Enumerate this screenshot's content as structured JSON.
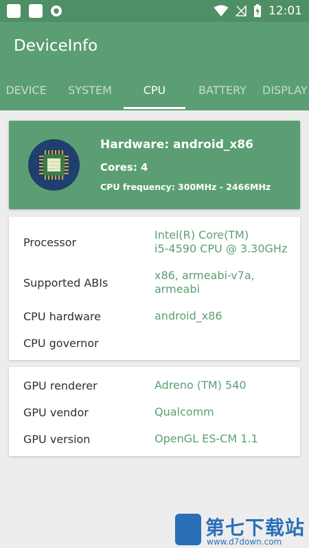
{
  "status_bar": {
    "time": "12:01"
  },
  "app_bar": {
    "title": "DeviceInfo",
    "tabs": [
      {
        "label": "DEVICE",
        "active": false
      },
      {
        "label": "SYSTEM",
        "active": false
      },
      {
        "label": "CPU",
        "active": true
      },
      {
        "label": "BATTERY",
        "active": false
      },
      {
        "label": "DISPLAY",
        "active": false
      }
    ]
  },
  "header_card": {
    "hardware": "Hardware: android_x86",
    "cores": "Cores: 4",
    "frequency": "CPU frequency: 300MHz - 2466MHz"
  },
  "cpu_card": {
    "rows": [
      {
        "label": "Processor",
        "value_line1": "Intel(R) Core(TM)",
        "value_line2": "i5-4590 CPU @ 3.30GHz"
      },
      {
        "label": "Supported ABIs",
        "value_line1": "x86, armeabi-v7a,",
        "value_line2": "armeabi"
      },
      {
        "label": "CPU hardware",
        "value_line1": "android_x86"
      },
      {
        "label": "CPU governor",
        "value_line1": ""
      }
    ]
  },
  "gpu_card": {
    "rows": [
      {
        "label": "GPU renderer",
        "value": "Adreno (TM) 540"
      },
      {
        "label": "GPU vendor",
        "value": "Qualcomm"
      },
      {
        "label": "GPU version",
        "value": "OpenGL ES-CM 1.1"
      }
    ]
  },
  "watermark": {
    "text": "第七下载站",
    "url": "www.d7down.com"
  },
  "colors": {
    "primary": "#5b9e73",
    "status_bar": "#4e8f65",
    "chip_bg": "#1f3f6e",
    "watermark": "#2a6fb8"
  }
}
